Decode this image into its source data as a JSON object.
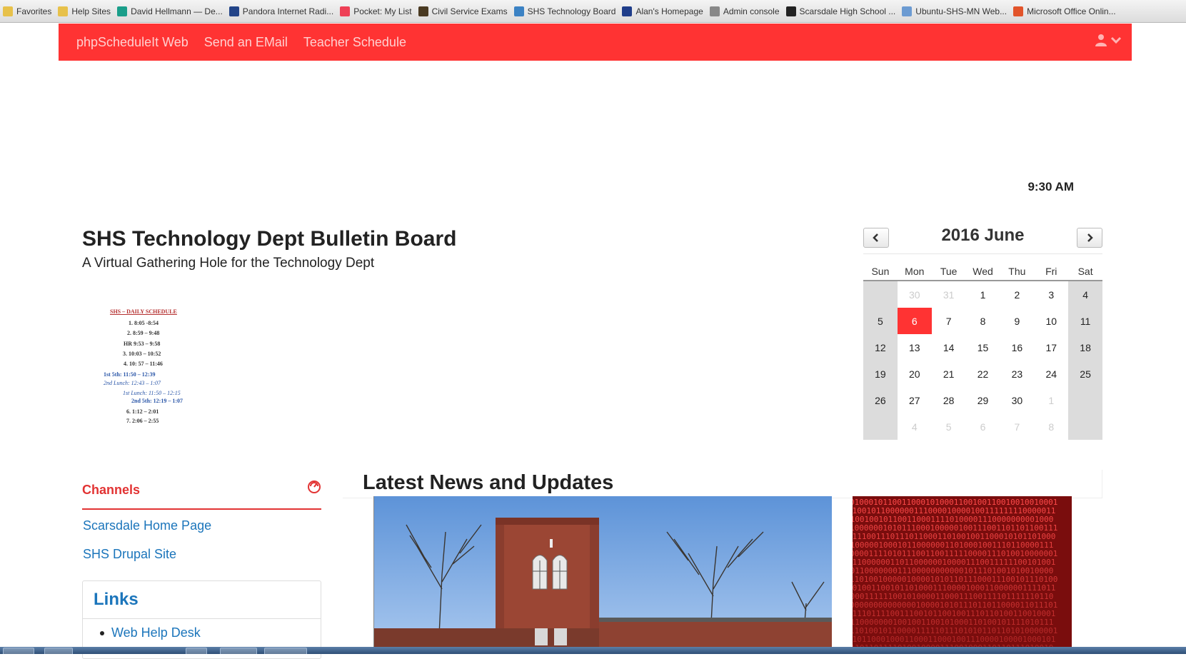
{
  "favorites": [
    {
      "label": "Favorites",
      "icon": "star-folder-icon",
      "color": "#e7c14a"
    },
    {
      "label": "Help Sites",
      "icon": "folder-icon",
      "color": "#e7c14a"
    },
    {
      "label": "David Hellmann — De...",
      "icon": "site-icon",
      "color": "#1a9e8a"
    },
    {
      "label": "Pandora Internet Radi...",
      "icon": "pandora-icon",
      "color": "#224488"
    },
    {
      "label": "Pocket: My List",
      "icon": "pocket-icon",
      "color": "#ee4056"
    },
    {
      "label": "Civil Service Exams",
      "icon": "site-icon",
      "color": "#4a3a22"
    },
    {
      "label": "SHS Technology Board",
      "icon": "globe-icon",
      "color": "#3b82c4"
    },
    {
      "label": "Alan's Homepage",
      "icon": "site-icon",
      "color": "#1f3d8a"
    },
    {
      "label": "Admin console",
      "icon": "globe-icon",
      "color": "#888888"
    },
    {
      "label": "Scarsdale High School ...",
      "icon": "blackboard-icon",
      "color": "#222222"
    },
    {
      "label": "Ubuntu-SHS-MN Web...",
      "icon": "globe-icon",
      "color": "#6c9bd2"
    },
    {
      "label": "Microsoft Office Onlin...",
      "icon": "office-icon",
      "color": "#e2542a"
    }
  ],
  "nav": {
    "items": [
      "phpScheduleIt Web",
      "Send an EMail",
      "Teacher Schedule"
    ]
  },
  "clock": "9:30 AM",
  "page": {
    "title": "SHS Technology Dept Bulletin Board",
    "subtitle": "A Virtual Gathering Hole for the Technology Dept"
  },
  "schedule": {
    "heading": "SHS – DAILY SCHEDULE",
    "lines": [
      "1. 8:05 -8:54",
      "2. 8:59 – 9:48",
      "HR 9:53 – 9:58",
      "3. 10:03 – 10:52",
      "4. 10: 57 – 11:46",
      "1st 5th: 11:50 – 12:39",
      "2nd Lunch: 12:43 – 1:07",
      "1st Lunch: 11:50 – 12:15",
      "2nd 5th: 12:19 – 1:07",
      "6. 1:12 – 2:01",
      "7. 2:06 – 2:55"
    ]
  },
  "calendar": {
    "month_label": "2016 June",
    "days_of_week": [
      "Sun",
      "Mon",
      "Tue",
      "Wed",
      "Thu",
      "Fri",
      "Sat"
    ],
    "weeks": [
      [
        {
          "d": "",
          "m": 1
        },
        {
          "d": "30",
          "m": 1
        },
        {
          "d": "31",
          "m": 1
        },
        {
          "d": "1"
        },
        {
          "d": "2"
        },
        {
          "d": "3"
        },
        {
          "d": "4"
        }
      ],
      [
        {
          "d": "5"
        },
        {
          "d": "6",
          "today": 1
        },
        {
          "d": "7"
        },
        {
          "d": "8"
        },
        {
          "d": "9"
        },
        {
          "d": "10"
        },
        {
          "d": "11"
        }
      ],
      [
        {
          "d": "12"
        },
        {
          "d": "13"
        },
        {
          "d": "14"
        },
        {
          "d": "15"
        },
        {
          "d": "16"
        },
        {
          "d": "17"
        },
        {
          "d": "18"
        }
      ],
      [
        {
          "d": "19"
        },
        {
          "d": "20"
        },
        {
          "d": "21"
        },
        {
          "d": "22"
        },
        {
          "d": "23"
        },
        {
          "d": "24"
        },
        {
          "d": "25"
        }
      ],
      [
        {
          "d": "26"
        },
        {
          "d": "27"
        },
        {
          "d": "28"
        },
        {
          "d": "29"
        },
        {
          "d": "30"
        },
        {
          "d": "1",
          "m": 1
        },
        {
          "d": "",
          "m": 1
        }
      ],
      [
        {
          "d": "",
          "m": 1
        },
        {
          "d": "4",
          "m": 1
        },
        {
          "d": "5",
          "m": 1
        },
        {
          "d": "6",
          "m": 1
        },
        {
          "d": "7",
          "m": 1
        },
        {
          "d": "8",
          "m": 1
        },
        {
          "d": "",
          "m": 1
        }
      ]
    ]
  },
  "channels": {
    "title": "Channels",
    "links": [
      "Scarsdale Home Page",
      "SHS Drupal Site"
    ]
  },
  "links_box": {
    "title": "Links",
    "items": [
      "Web Help Desk"
    ]
  },
  "news": {
    "title": "Latest News and Updates"
  },
  "colors": {
    "brand_red": "#ff3333",
    "link_blue": "#1b75bb",
    "weekend_gray": "#dcdcdc"
  }
}
